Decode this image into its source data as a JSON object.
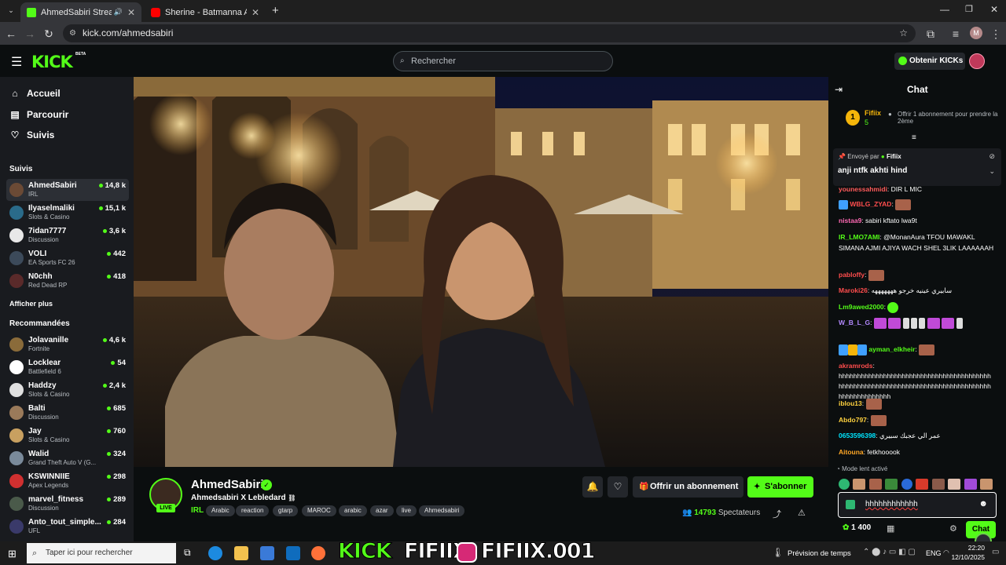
{
  "browser": {
    "tabs": [
      {
        "title": "AhmedSabiri Stream - Watc",
        "active": true
      },
      {
        "title": "Sherine - Batmanna Ansak | لتو",
        "active": false
      }
    ],
    "new_tab": "+",
    "url": "kick.com/ahmedsabiri",
    "profile_initial": "M"
  },
  "header": {
    "logo": "KICK",
    "logo_badge": "BETA",
    "search_placeholder": "Rechercher",
    "get_kicks": "Obtenir KICKs"
  },
  "sidebar": {
    "nav": [
      {
        "label": "Accueil",
        "icon": "home-icon"
      },
      {
        "label": "Parcourir",
        "icon": "browse-icon"
      },
      {
        "label": "Suivis",
        "icon": "heart-icon"
      }
    ],
    "followed_title": "Suivis",
    "followed": [
      {
        "name": "AhmedSabiri",
        "category": "IRL",
        "viewers": "14,8 k"
      },
      {
        "name": "Ilyaselmaliki",
        "category": "Slots & Casino",
        "viewers": "15,1 k"
      },
      {
        "name": "7idan7777",
        "category": "Discussion",
        "viewers": "3,6 k"
      },
      {
        "name": "VOLI",
        "category": "EA Sports FC 26",
        "viewers": "442"
      },
      {
        "name": "N0chh",
        "category": "Red Dead RP",
        "viewers": "418"
      }
    ],
    "show_more": "Afficher plus",
    "recommended_title": "Recommandées",
    "recommended": [
      {
        "name": "Jolavanille",
        "category": "Fortnite",
        "viewers": "4,6 k"
      },
      {
        "name": "Locklear",
        "category": "Battlefield 6",
        "viewers": "54"
      },
      {
        "name": "Haddzy",
        "category": "Slots & Casino",
        "viewers": "2,4 k"
      },
      {
        "name": "Balti",
        "category": "Discussion",
        "viewers": "685"
      },
      {
        "name": "Jay",
        "category": "Slots & Casino",
        "viewers": "760"
      },
      {
        "name": "Walid",
        "category": "Grand Theft Auto V (G...",
        "viewers": "324"
      },
      {
        "name": "KSWINNIIE",
        "category": "Apex Legends",
        "viewers": "298"
      },
      {
        "name": "marvel_fitness",
        "category": "Discussion",
        "viewers": "289"
      },
      {
        "name": "Anto_tout_simple...",
        "category": "UFL",
        "viewers": "284"
      }
    ]
  },
  "stream": {
    "channel": "AhmedSabiri",
    "title": "Ahmedsabiri X Lebledard",
    "live": "LIVE",
    "category": "IRL",
    "tags": [
      "Arabic",
      "reaction",
      "gtarp",
      "MAROC",
      "arabic",
      "azar",
      "live",
      "Ahmedsabiri"
    ],
    "gift_sub": "Offrir un abonnement",
    "subscribe": "S'abonner",
    "viewers": "14793",
    "viewers_label": "Spectateurs"
  },
  "chat": {
    "title": "Chat",
    "gifter_name": "Fifiix",
    "gifter_count": "5",
    "gift_offer": "Offrir 1 abonnement pour prendre la 2ème",
    "pinned_by_label": "Envoyé par",
    "pinned_by": "Fifiix",
    "pinned_text": "anji ntfk akhti hind",
    "messages": [
      {
        "user": "younessahmidi",
        "text": "DIR L MIC",
        "color": "#ff5b5b"
      },
      {
        "user": "WBLG_ZYAD",
        "text": "",
        "color": "#ff4d4d"
      },
      {
        "user": "nistaa9",
        "text": "sabiri kftato lwa9t",
        "color": "#ff69b4"
      },
      {
        "user": "IR_LMO7AMI",
        "text": "@MonanAura TFOU MAWAKL SIMANA AJMI AJIYA WACH SHEL 3LIK LAAAAAAH",
        "color": "#53fc18"
      },
      {
        "user": "pabloffy",
        "text": "",
        "color": "#ff4d4d"
      },
      {
        "user": "Maroki26",
        "text": "سابيري عينيه خرجو هههههههه",
        "color": "#ff4d4d"
      },
      {
        "user": "Lm9awed2000",
        "text": "",
        "color": "#53fc18"
      },
      {
        "user": "W_B_L_G",
        "text": "",
        "color": "#b388ff"
      },
      {
        "user": "ayman_elkheir",
        "text": "",
        "color": "#53fc18"
      },
      {
        "user": "akramrods",
        "text": "hhhhhhhhhhhhhhhhhhhhhhhhhhhhhhhhhhhhhhhhhhhhhhhhhhhhhhhhhhhhhhhhhhhhhhhhhhhhhhhhhhhhhhhhhhhhhhhh",
        "color": "#ff4d4d"
      },
      {
        "user": "iblou13",
        "text": "",
        "color": "#ffd23f"
      },
      {
        "user": "Abdo797",
        "text": "",
        "color": "#ffd23f"
      },
      {
        "user": "0653596398",
        "text": "عمر الي عجبك سبيري",
        "color": "#00e5ff"
      },
      {
        "user": "Aitouna",
        "text": "fetkhooook",
        "color": "#ffa726"
      }
    ],
    "slow_mode": "Mode lent activé",
    "input_value": "hhhhhhhhhhhh",
    "points": "1 400",
    "send": "Chat"
  },
  "overlay": {
    "kick_word": "KICK",
    "name": "FIFIIX",
    "handle": "FIFIIX.001"
  },
  "taskbar": {
    "search_placeholder": "Taper ici pour rechercher",
    "weather": "Prévision de temps",
    "lang": "ENG",
    "time": "22:20",
    "date": "12/10/2025"
  },
  "colors": {
    "kick_green": "#53fc18",
    "bg": "#0b0e0f",
    "sidebar": "#191b1f"
  }
}
